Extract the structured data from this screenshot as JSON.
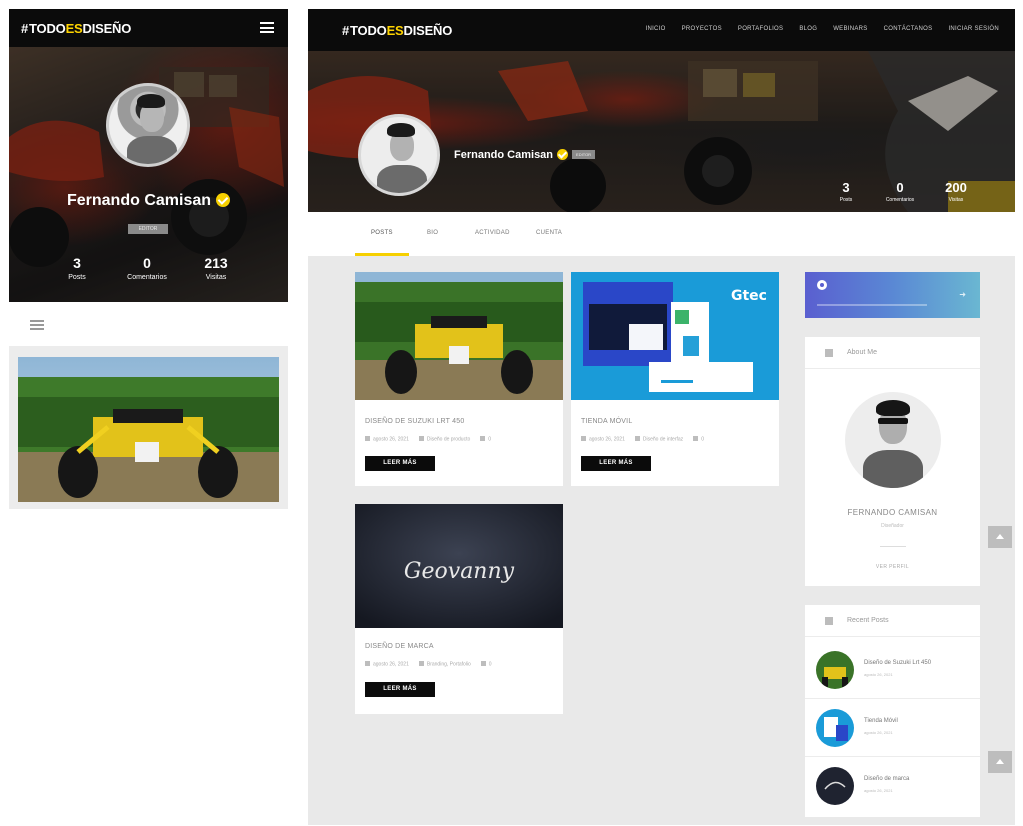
{
  "brand": {
    "hash": "#",
    "left": "TODO",
    "mid": "ES",
    "right": "DISEÑO"
  },
  "profile": {
    "name": "Fernando Camisan",
    "role_badge": "EDITOR"
  },
  "mobile": {
    "stats": [
      {
        "value": "3",
        "label": "Posts"
      },
      {
        "value": "0",
        "label": "Comentarios"
      },
      {
        "value": "213",
        "label": "Visitas"
      }
    ]
  },
  "desktop": {
    "nav": [
      "INICIO",
      "PROYECTOS",
      "PORTAFOLIOS",
      "BLOG",
      "WEBINARS",
      "CONTÁCTANOS",
      "INICIAR SESIÓN"
    ],
    "stats": [
      {
        "value": "3",
        "label": "Posts"
      },
      {
        "value": "0",
        "label": "Comentarios"
      },
      {
        "value": "200",
        "label": "Visitas"
      }
    ],
    "tabs": [
      "POSTS",
      "BIO",
      "ACTIVIDAD",
      "CUENTA"
    ],
    "posts": [
      {
        "title": "DISEÑO DE SUZUKI LRT 450",
        "date": "agosto 26, 2021",
        "category": "Diseño de producto",
        "comments": "0",
        "button": "LEER MÁS"
      },
      {
        "title": "TIENDA MÓVIL",
        "date": "agosto 26, 2021",
        "category": "Diseño de interfaz",
        "comments": "0",
        "button": "LEER MÁS"
      },
      {
        "title": "DISEÑO DE MARCA",
        "date": "agosto 26, 2021",
        "category": "Branding, Portafolio",
        "comments": "0",
        "button": "LEER MÁS"
      }
    ],
    "thumb_texts": {
      "gtec": "Gtec",
      "signature": "Geovanny"
    },
    "about": {
      "title": "About Me",
      "name": "FERNANDO CAMISAN",
      "role": "Diseñador",
      "link": "VER PERFIL"
    },
    "recent": {
      "title": "Recent Posts",
      "items": [
        {
          "title": "Diseño de Suzuki Lrt 450",
          "date": "agosto 26, 2021"
        },
        {
          "title": "Tienda Móvil",
          "date": "agosto 26, 2021"
        },
        {
          "title": "Diseño de marca",
          "date": "agosto 26, 2021"
        }
      ]
    }
  },
  "colors": {
    "accent": "#f6d000",
    "dark": "#0b0b0b",
    "bg": "#e9e9e9",
    "banner_start": "#5a5fd0",
    "banner_end": "#6ab7d2"
  }
}
